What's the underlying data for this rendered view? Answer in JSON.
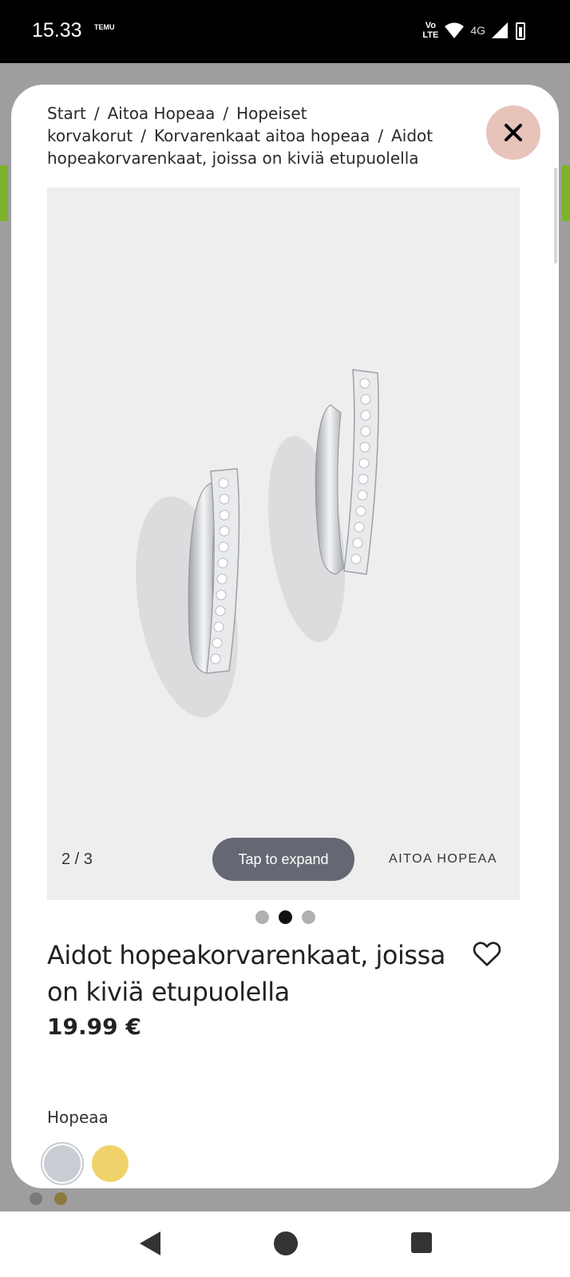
{
  "status_bar": {
    "time": "15.33",
    "app_indicator": "TEMU",
    "volte_line1": "Vo",
    "volte_line2": "LTE",
    "network": "4G"
  },
  "breadcrumb": [
    {
      "label": "Start"
    },
    {
      "label": "Aitoa Hopeaa"
    },
    {
      "label": "Hopeiset korvakorut"
    },
    {
      "label": "Korvarenkaat aitoa hopeaa"
    },
    {
      "label": "Aidot hopeakorvarenkaat, joissa on kiviä etupuolella"
    }
  ],
  "gallery": {
    "counter": "2 / 3",
    "expand_label": "Tap to expand",
    "brand": "AITOA HOPEAA",
    "dots": [
      false,
      true,
      false
    ]
  },
  "product": {
    "title": "Aidot hopeakorvarenkaat, joissa on kiviä etupuolella",
    "price": "19.99 €",
    "color_name": "Hopeaa"
  },
  "swatches": [
    {
      "name": "Hopeaa",
      "color": "#c9ccd3"
    },
    {
      "name": "Kulta",
      "color": "#efd36a"
    }
  ],
  "help": {
    "symbol": "?",
    "dots": ".."
  },
  "icons": {
    "close": "close-icon",
    "wishlist": "heart-icon",
    "help": "chat-help-icon"
  }
}
